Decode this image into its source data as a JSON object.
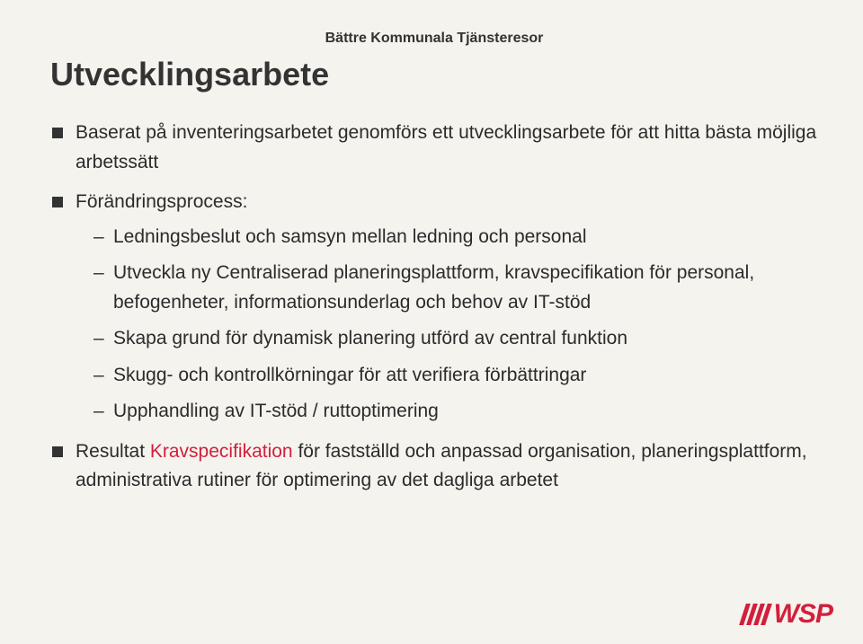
{
  "header_label": "Bättre Kommunala Tjänsteresor",
  "title": "Utvecklingsarbete",
  "bullets": {
    "b1": "Baserat på inventeringsarbetet genomförs ett utvecklingsarbete för att hitta bästa möjliga arbetssätt",
    "b2": "Förändringsprocess:",
    "b2_sub": {
      "s1": "Ledningsbeslut och samsyn mellan ledning och personal",
      "s2": "Utveckla ny Centraliserad planeringsplattform, kravspecifikation för personal, befogenheter, informationsunderlag och behov av IT-stöd",
      "s3": "Skapa grund för dynamisk planering utförd av central funktion",
      "s4": "Skugg- och kontrollkörningar för att verifiera förbättringar",
      "s5": "Upphandling av IT-stöd / ruttoptimering"
    },
    "b3_prefix": "Resultat ",
    "b3_red": "Kravspecifikation",
    "b3_rest": " för fastställd och anpassad organisation, planeringsplattform, administrativa rutiner för optimering av det dagliga arbetet"
  },
  "logo_text": "WSP"
}
